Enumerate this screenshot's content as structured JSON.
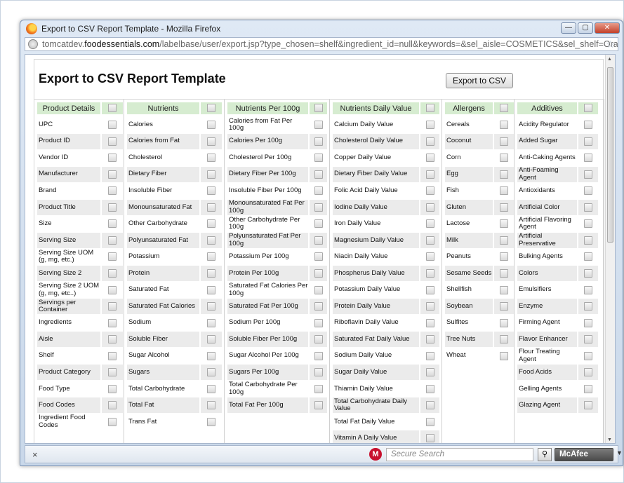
{
  "window": {
    "title": "Export to CSV Report Template - Mozilla Firefox",
    "url_prefix": "tomcatdev.",
    "url_domain": "foodessentials.com",
    "url_path": "/labelbase/user/export.jsp?type_chosen=shelf&ingredient_id=null&keywords=&sel_aisle=COSMETICS&sel_shelf=Oral+Hygiene",
    "btn_min": "—",
    "btn_max": "▢",
    "btn_close": "✕"
  },
  "page": {
    "title": "Export to CSV Report Template",
    "export_button": "Export to CSV"
  },
  "columns": [
    {
      "header": "Product Details",
      "items": [
        "UPC",
        "Product ID",
        "Vendor ID",
        "Manufacturer",
        "Brand",
        "Product Title",
        "Size",
        "Serving Size",
        "Serving Size UOM (g, mg, etc.)",
        "Serving Size 2",
        "Serving Size 2 UOM (g, mg, etc..)",
        "Servings per Container",
        "Ingredients",
        "Aisle",
        "Shelf",
        "Product Category",
        "Food Type",
        "Food Codes",
        "Ingredient Food Codes"
      ]
    },
    {
      "header": "Nutrients",
      "items": [
        "Calories",
        "Calories from Fat",
        "Cholesterol",
        "Dietary Fiber",
        "Insoluble Fiber",
        "Monounsaturated Fat",
        "Other Carbohydrate",
        "Polyunsaturated Fat",
        "Potassium",
        "Protein",
        "Saturated Fat",
        "Saturated Fat Calories",
        "Sodium",
        "Soluble Fiber",
        "Sugar Alcohol",
        "Sugars",
        "Total Carbohydrate",
        "Total Fat",
        "Trans Fat"
      ]
    },
    {
      "header": "Nutrients Per 100g",
      "items": [
        "Calories from Fat Per 100g",
        "Calories Per 100g",
        "Cholesterol Per 100g",
        "Dietary Fiber Per 100g",
        "Insoluble Fiber Per 100g",
        "Monounsaturated Fat Per 100g",
        "Other Carbohydrate Per 100g",
        "Polyunsaturated Fat Per 100g",
        "Potassium Per 100g",
        "Protein Per 100g",
        "Saturated Fat Calories Per 100g",
        "Saturated Fat Per 100g",
        "Sodium Per 100g",
        "Soluble Fiber Per 100g",
        "Sugar Alcohol Per 100g",
        "Sugars Per 100g",
        "Total Carbohydrate Per 100g",
        "Total Fat Per 100g"
      ]
    },
    {
      "header": "Nutrients Daily Value",
      "items": [
        "Calcium Daily Value",
        "Cholesterol Daily Value",
        "Copper Daily Value",
        "Dietary Fiber Daily Value",
        "Folic Acid Daily Value",
        "Iodine Daily Value",
        "Iron Daily Value",
        "Magnesium Daily Value",
        "Niacin Daily Value",
        "Phospherus Daily Value",
        "Potassium Daily Value",
        "Protein Daily Value",
        "Riboflavin Daily Value",
        "Saturated Fat Daily Value",
        "Sodium Daily Value",
        "Sugar Daily Value",
        "Thiamin Daily Value",
        "Total Carbohydrate Daily Value",
        "Total Fat Daily Value",
        "Vitamin A Daily Value"
      ]
    },
    {
      "header": "Allergens",
      "items": [
        "Cereals",
        "Coconut",
        "Corn",
        "Egg",
        "Fish",
        "Gluten",
        "Lactose",
        "Milk",
        "Peanuts",
        "Sesame Seeds",
        "Shellfish",
        "Soybean",
        "Sulfites",
        "Tree Nuts",
        "Wheat"
      ]
    },
    {
      "header": "Additives",
      "items": [
        "Acidity Regulator",
        "Added Sugar",
        "Anti-Caking Agents",
        "Anti-Foaming Agent",
        "Antioxidants",
        "Artificial Color",
        "Artificial Flavoring Agent",
        "Artificial Preservative",
        "Bulking Agents",
        "Colors",
        "Emulsifiers",
        "Enzyme",
        "Firming Agent",
        "Flavor Enhancer",
        "Flour Treating Agent",
        "Food Acids",
        "Gelling Agents",
        "Glazing Agent"
      ]
    }
  ],
  "statusbar": {
    "close": "×",
    "search_placeholder": "Secure Search",
    "search_icon": "⚲",
    "mcafee_m": "M",
    "mcafee_label": "McAfee",
    "dropdown": "▼"
  }
}
